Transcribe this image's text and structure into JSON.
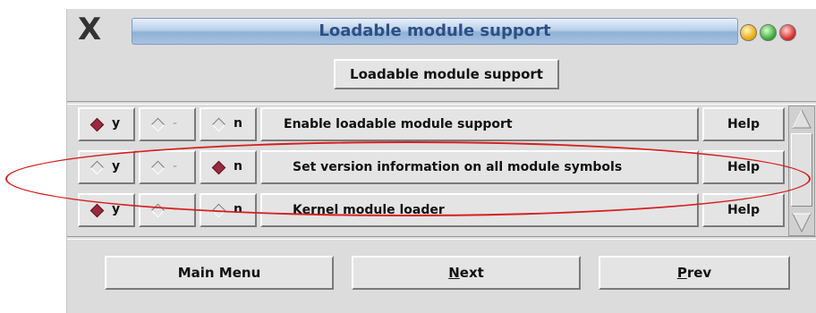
{
  "window": {
    "logo": "X",
    "title": "Loadable module support"
  },
  "header_button": "Loadable module support",
  "rows": [
    {
      "y": {
        "label": "y",
        "selected": true
      },
      "m": {
        "label": "-",
        "selected": false
      },
      "n": {
        "label": "n",
        "selected": false
      },
      "description": "Enable loadable module support",
      "help": "Help"
    },
    {
      "y": {
        "label": "y",
        "selected": false
      },
      "m": {
        "label": "-",
        "selected": false
      },
      "n": {
        "label": "n",
        "selected": true
      },
      "description": "Set version information on all module symbols",
      "help": "Help"
    },
    {
      "y": {
        "label": "y",
        "selected": true
      },
      "m": {
        "label": "-",
        "selected": false
      },
      "n": {
        "label": "n",
        "selected": false
      },
      "description": "Kernel module loader",
      "help": "Help"
    }
  ],
  "nav": {
    "main_menu": "Main Menu",
    "next_underline": "N",
    "next_rest": "ext",
    "prev_underline": "P",
    "prev_rest": "rev"
  },
  "colors": {
    "selected_diamond": "#9c2a3e",
    "highlight_ellipse": "#d42020",
    "title_text": "#2d4f86"
  }
}
